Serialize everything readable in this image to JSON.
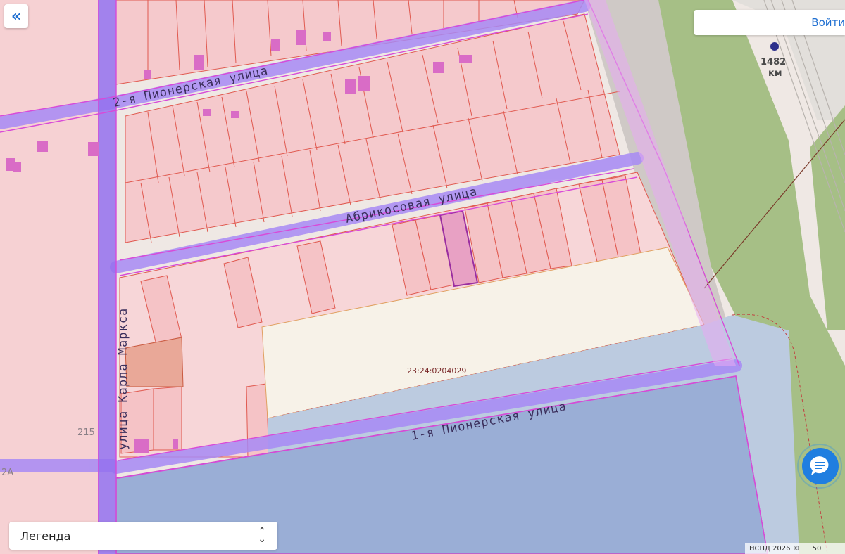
{
  "map": {
    "streets": {
      "pionerskaya2": "2-я Пионерская улица",
      "abrikosovaya": "Абрикосовая улица",
      "pionerskaya1": "1-я Пионерская улица",
      "karla_marksa": "улица Карла Маркса"
    },
    "cadastral_number": "23:24:0204029",
    "house_number": "215",
    "edge_fragment": "2А",
    "railway_km_value": "1482",
    "railway_km_unit": "км"
  },
  "ui": {
    "collapse_icon": "«",
    "login_label": "Войти",
    "legend_label": "Легенда",
    "attribution": "НСПД 2026 ©",
    "scale_label": "50"
  },
  "icons": {
    "collapse": "double-chevron-left-icon",
    "chat": "chat-bubble-icon",
    "select": "chevron-updown-icon"
  },
  "colors": {
    "parcel_fill": "#f5c9cc",
    "parcel_stroke": "#e0594f",
    "street_purple": "#9a6ff0",
    "zone_magenta": "#d84ad8",
    "water_blue": "#9aaed6",
    "selected_parcel": "#e8a1c4",
    "accent_blue": "#1f6fd1"
  }
}
